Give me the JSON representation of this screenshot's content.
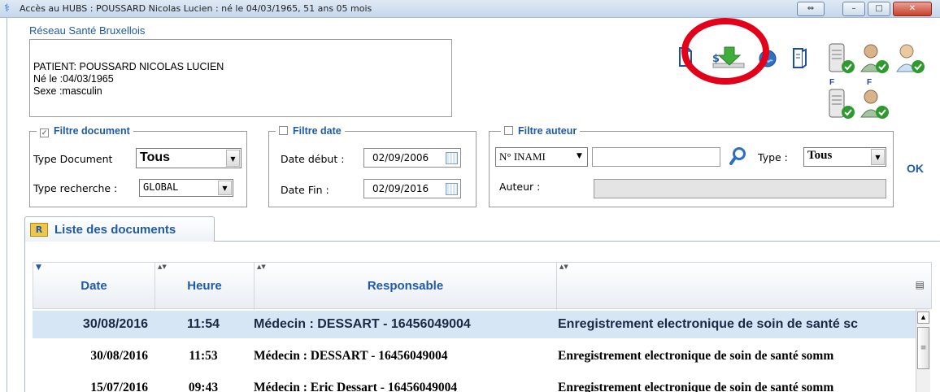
{
  "window": {
    "title": "Accès au HUBS : POUSSARD Nicolas Lucien : né le 04/03/1965, 51 ans 05 mois",
    "controls": {
      "restore_alt": "⇔",
      "minimize": "–",
      "maximize": "□",
      "close": "✕"
    }
  },
  "network": "Réseau Santé Bruxellois",
  "patient": {
    "line1": "PATIENT: POUSSARD NICOLAS LUCIEN",
    "line2": "Né le :04/03/1965",
    "line3": "Sexe :masculin"
  },
  "toolbar": {
    "icons": [
      "document-icon",
      "download-icon",
      "globe-icon",
      "folder-doc-icon",
      "server-check-icon",
      "doctor-check-icon",
      "doctor-check-alt-icon",
      "server-check-f-icon",
      "doctor-check-f-icon"
    ],
    "f_label_1": "F",
    "f_label_2": "F",
    "highlight_color": "#e2001a"
  },
  "filter_document": {
    "legend": "Filtre document",
    "checked": true,
    "type_label": "Type Document",
    "type_value": "Tous",
    "search_label": "Type recherche :",
    "search_value": "GLOBAL"
  },
  "filter_date": {
    "legend": "Filtre date",
    "checked": false,
    "start_label": "Date début :",
    "start_value": "02/09/2006",
    "end_label": "Date Fin :",
    "end_value": "02/09/2016"
  },
  "filter_author": {
    "legend": "Filtre auteur",
    "checked": false,
    "id_type": "N° INAMI",
    "search_value": "",
    "type_label": "Type :",
    "type_value": "Tous",
    "author_label": "Auteur :",
    "author_value": ""
  },
  "ok_label": "OK",
  "tab": {
    "label": "Liste des documents",
    "icon": "folder-icon"
  },
  "grid": {
    "headers": [
      "Date",
      "Heure",
      "Responsable",
      ""
    ],
    "rows": [
      {
        "date": "30/08/2016",
        "heure": "11:54",
        "responsable": "Médecin :   DESSART - 16456049004",
        "document": "Enregistrement electronique de soin de santé sc",
        "selected": true
      },
      {
        "date": "30/08/2016",
        "heure": "11:53",
        "responsable": "Médecin :  DESSART - 16456049004",
        "document": "Enregistrement electronique de soin de santé somm",
        "selected": false
      },
      {
        "date": "15/07/2016",
        "heure": "09:43",
        "responsable": "Médecin :  Eric Dessart - 16456049004",
        "document": "Enregistrement electronique de soin de santé somm",
        "selected": false
      }
    ]
  },
  "colors": {
    "accent": "#1f5aa8",
    "selected_row": "#d6e6f5"
  }
}
